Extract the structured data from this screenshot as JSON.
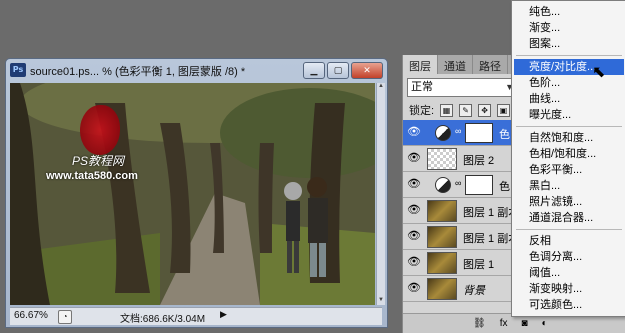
{
  "document": {
    "title": "source01.ps... % (色彩平衡 1, 图层蒙版 /8) *",
    "zoom": "66.67%",
    "doc_size": "文档:686.6K/3.04M",
    "watermark_line1": "PS教程网",
    "watermark_line2": "www.tata580.com"
  },
  "layers_panel": {
    "tabs": [
      "图层",
      "通道",
      "路径"
    ],
    "blend_mode": "正常",
    "lock_label": "锁定:",
    "layers": [
      {
        "name": "色",
        "type": "adjustment",
        "selected": true
      },
      {
        "name": "图层 2",
        "type": "check"
      },
      {
        "name": "色",
        "type": "adjustment"
      },
      {
        "name": "图层 1 副本",
        "type": "photo"
      },
      {
        "name": "图层 1 副本",
        "type": "photo"
      },
      {
        "name": "图层 1",
        "type": "photo"
      },
      {
        "name": "背景",
        "type": "photo",
        "italic": true
      }
    ]
  },
  "menu": {
    "groups": [
      [
        "纯色...",
        "渐变...",
        "图案..."
      ],
      [
        "亮度/对比度...",
        "色阶...",
        "曲线...",
        "曝光度..."
      ],
      [
        "自然饱和度...",
        "色相/饱和度...",
        "色彩平衡...",
        "黑白...",
        "照片滤镜...",
        "通道混合器..."
      ],
      [
        "反相",
        "色调分离...",
        "阈值...",
        "渐变映射...",
        "可选颜色..."
      ]
    ],
    "highlighted": "亮度/对比度..."
  },
  "colors": {
    "highlight": "#2f6ad8",
    "selected_layer": "#3a6fd8"
  }
}
